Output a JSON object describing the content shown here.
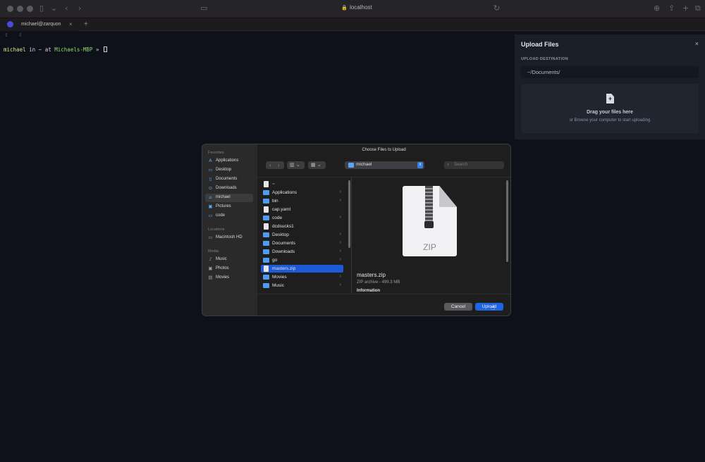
{
  "browser": {
    "url": "localhost",
    "tab_title": "michael@zarquon",
    "tab_close": "×",
    "new_tab": "+"
  },
  "terminal": {
    "toolbar_icons": "⇪ ⇩",
    "prompt_user": "michael",
    "prompt_in": " in ",
    "prompt_dir": "~",
    "prompt_at": " at ",
    "prompt_host": "Michaels-MBP",
    "prompt_arrow": " » "
  },
  "upload_panel": {
    "title": "Upload Files",
    "close": "×",
    "destination_label": "UPLOAD DESTINATION",
    "destination_value": "~/Documents/",
    "drop_title": "Drag your files here",
    "drop_subtitle": "or Browse your computer to start uploading"
  },
  "dialog": {
    "title": "Choose Files to Upload",
    "sidebar": {
      "favorites_label": "Favorites",
      "favorites": [
        {
          "label": "Applications",
          "icon": "applications-icon"
        },
        {
          "label": "Desktop",
          "icon": "desktop-icon"
        },
        {
          "label": "Documents",
          "icon": "documents-icon"
        },
        {
          "label": "Downloads",
          "icon": "downloads-icon"
        },
        {
          "label": "michael",
          "icon": "home-icon"
        },
        {
          "label": "Pictures",
          "icon": "pictures-icon"
        },
        {
          "label": "code",
          "icon": "folder-icon"
        }
      ],
      "locations_label": "Locations",
      "locations": [
        {
          "label": "Macintosh HD",
          "icon": "disk-icon"
        }
      ],
      "media_label": "Media",
      "media": [
        {
          "label": "Music",
          "icon": "music-icon"
        },
        {
          "label": "Photos",
          "icon": "photos-icon"
        },
        {
          "label": "Movies",
          "icon": "movies-icon"
        }
      ]
    },
    "location": "michael",
    "search_placeholder": "Search",
    "files": [
      {
        "name": "~",
        "type": "file",
        "has_children": false
      },
      {
        "name": "Applications",
        "type": "folder",
        "has_children": true
      },
      {
        "name": "bin",
        "type": "folder",
        "has_children": true
      },
      {
        "name": "cap.yaml",
        "type": "file",
        "has_children": false
      },
      {
        "name": "code",
        "type": "folder",
        "has_children": true
      },
      {
        "name": "dcdsucks1",
        "type": "file",
        "has_children": false
      },
      {
        "name": "Desktop",
        "type": "folder",
        "has_children": true
      },
      {
        "name": "Documents",
        "type": "folder",
        "has_children": true
      },
      {
        "name": "Downloads",
        "type": "folder",
        "has_children": true
      },
      {
        "name": "go",
        "type": "folder",
        "has_children": true
      },
      {
        "name": "masters.zip",
        "type": "zip",
        "has_children": false,
        "selected": true
      },
      {
        "name": "Movies",
        "type": "folder",
        "has_children": true
      },
      {
        "name": "Music",
        "type": "folder",
        "has_children": true
      }
    ],
    "preview": {
      "icon_text": "ZIP",
      "name": "masters.zip",
      "meta": "ZIP archive - 499.3 MB",
      "info_label": "Information"
    },
    "buttons": {
      "cancel": "Cancel",
      "upload": "Upload"
    }
  },
  "colors": {
    "accent": "#1f64e0",
    "folder": "#4e9cf0",
    "prompt_user": "#e4e48a",
    "prompt_host": "#8fd873"
  }
}
